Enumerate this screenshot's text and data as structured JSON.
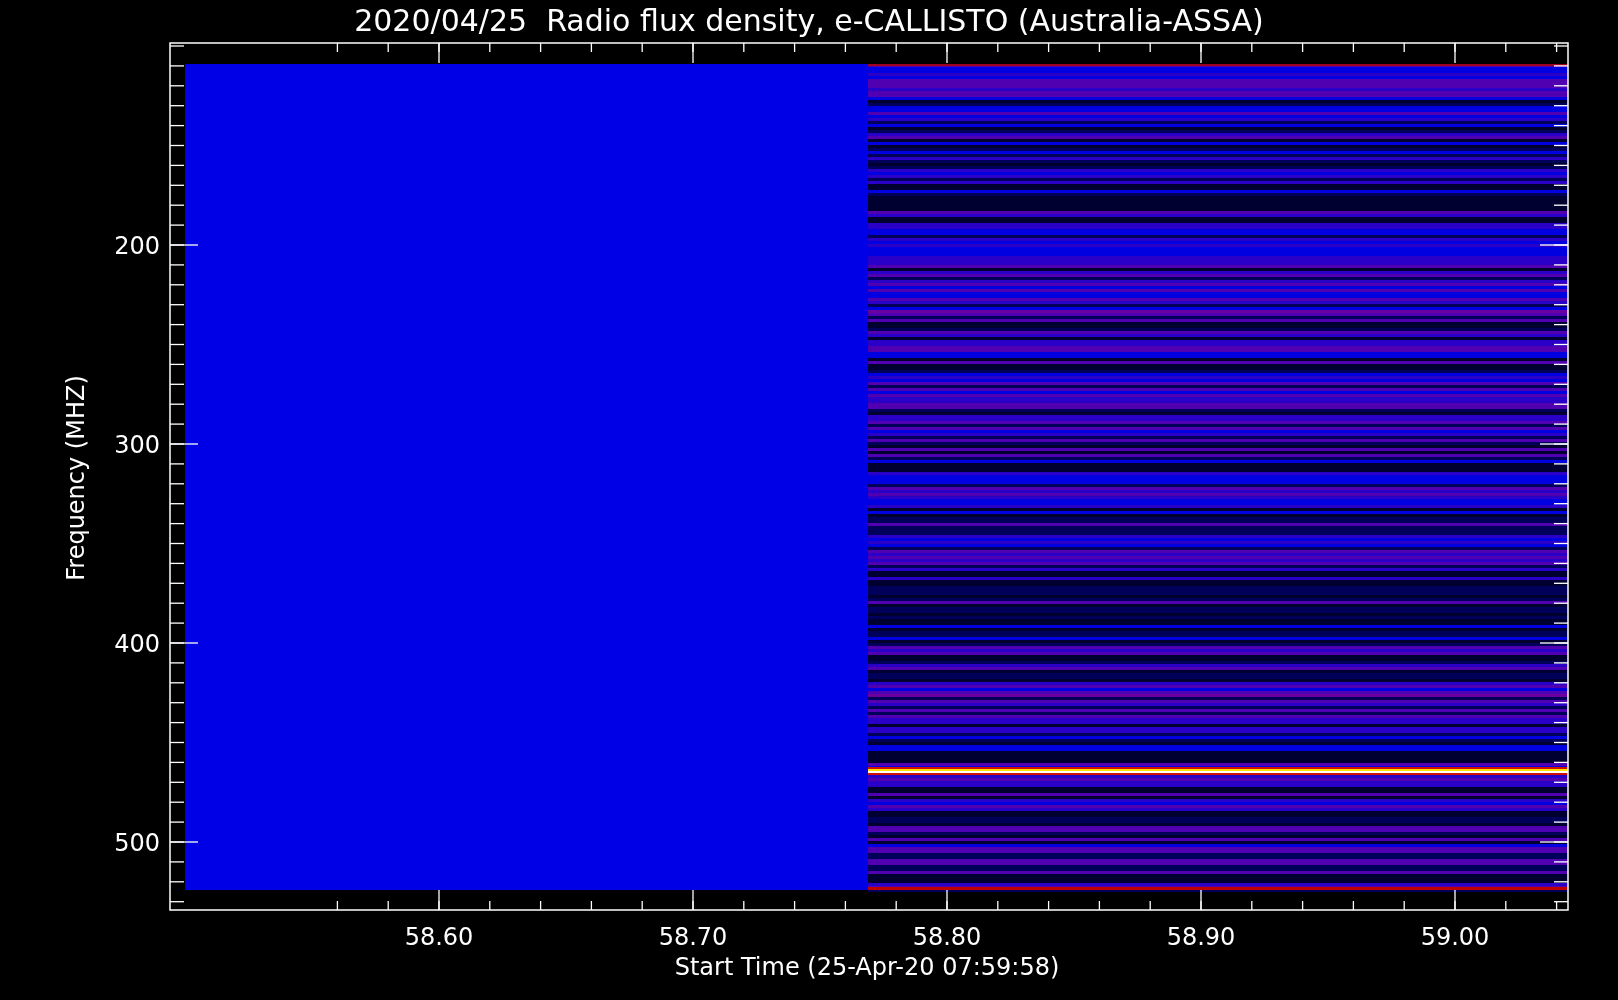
{
  "title": "2020/04/25  Radio flux density, e-CALLISTO (Australia-ASSA)",
  "x_axis": {
    "label": "Start Time (25-Apr-20 07:59:58)",
    "ticks": [
      "58.60",
      "58.70",
      "58.80",
      "58.90",
      "59.00"
    ]
  },
  "y_axis": {
    "label": "Frequency (MHZ)",
    "ticks": [
      "200",
      "300",
      "400",
      "500"
    ]
  }
}
